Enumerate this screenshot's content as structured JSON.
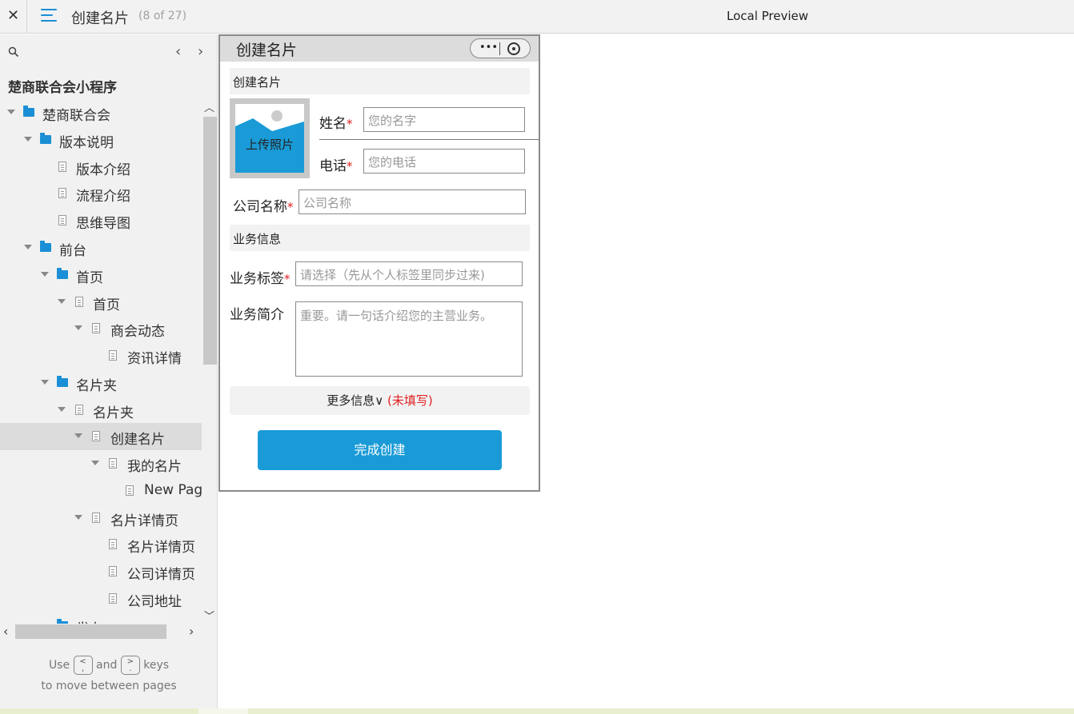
{
  "topbar": {
    "close_glyph": "✕",
    "menu_icon": "hamburger-menu-icon",
    "page_title": "创建名片",
    "page_count": "(8 of 27)",
    "preview_label": "Local Preview"
  },
  "sidebar": {
    "project_title": "楚商联合会小程序",
    "prev_glyph": "‹",
    "next_glyph": "›",
    "tree": [
      {
        "label": "楚商联合会",
        "kind": "folder",
        "expanded": true
      },
      {
        "label": "版本说明",
        "kind": "folder",
        "expanded": true
      },
      {
        "label": "版本介绍",
        "kind": "page"
      },
      {
        "label": "流程介绍",
        "kind": "page"
      },
      {
        "label": "思维导图",
        "kind": "page"
      },
      {
        "label": "前台",
        "kind": "folder",
        "expanded": true
      },
      {
        "label": "首页",
        "kind": "folder",
        "expanded": true
      },
      {
        "label": "首页",
        "kind": "page",
        "expanded": true
      },
      {
        "label": "商会动态",
        "kind": "page",
        "expanded": true
      },
      {
        "label": "资讯详情",
        "kind": "page"
      },
      {
        "label": "名片夹",
        "kind": "folder",
        "expanded": true
      },
      {
        "label": "名片夹",
        "kind": "page",
        "expanded": true
      },
      {
        "label": "创建名片",
        "kind": "page",
        "expanded": true,
        "active": true
      },
      {
        "label": "我的名片",
        "kind": "page",
        "expanded": true
      },
      {
        "label": "New Page",
        "kind": "page"
      },
      {
        "label": "名片详情页",
        "kind": "page",
        "expanded": true
      },
      {
        "label": "名片详情页",
        "kind": "page"
      },
      {
        "label": "公司详情页",
        "kind": "page"
      },
      {
        "label": "公司地址",
        "kind": "page"
      },
      {
        "label": "发布",
        "kind": "folder"
      }
    ],
    "hint": {
      "use": "Use",
      "and": "and",
      "keys": "keys",
      "line2": "to move between pages",
      "key_prev_top": "<",
      "key_prev_bottom": ",",
      "key_next_top": ">",
      "key_next_bottom": "."
    }
  },
  "phone": {
    "header_title": "创建名片",
    "capsule_dots": "•••",
    "section_card": "创建名片",
    "upload_label": "上传照片",
    "fields": {
      "name_label": "姓名",
      "name_placeholder": "您的名字",
      "phone_label": "电话",
      "phone_placeholder": "您的电话",
      "company_label": "公司名称",
      "company_placeholder": "公司名称",
      "tags_label": "业务标签",
      "tags_placeholder": "请选择（先从个人标签里同步过来)",
      "intro_label": "业务简介",
      "intro_placeholder": "重要。请一句话介绍您的主营业务。",
      "required_mark": "*"
    },
    "section_business": "业务信息",
    "more_info_label": "更多信息∨",
    "more_info_status": "(未填写)",
    "submit_label": "完成创建"
  },
  "colors": {
    "accent": "#1a9bd7",
    "required": "#e02020",
    "sidebar_bg": "#f1f1f1"
  }
}
